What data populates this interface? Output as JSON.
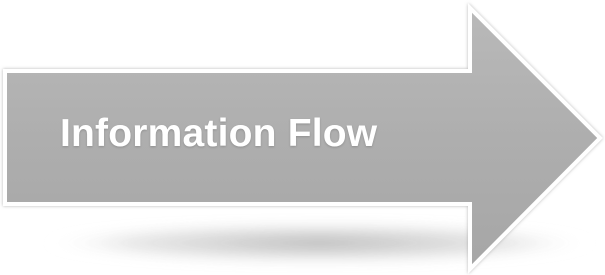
{
  "arrow": {
    "label": "Information Flow",
    "fill_color": "#aeaeae",
    "border_color": "#ffffff",
    "shadow_color": "#9a9a9a"
  }
}
